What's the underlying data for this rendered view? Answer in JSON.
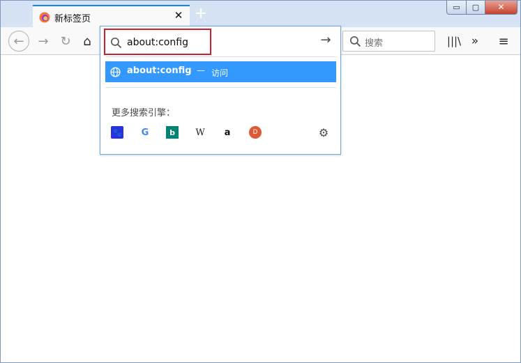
{
  "tab": {
    "title": "新标签页",
    "close_glyph": "✕"
  },
  "new_tab_glyph": "+",
  "window_controls": {
    "minimize": "▭",
    "maximize": "▢",
    "close": "✕"
  },
  "toolbar": {
    "back_icon": "←",
    "forward_icon": "→",
    "reload_icon": "↻",
    "home_icon": "⌂",
    "search_placeholder": "搜索",
    "library_icon": "|||\\",
    "overflow_icon": "»",
    "menu_icon": "≡"
  },
  "urlbar": {
    "value": "about:config",
    "go_icon": "→"
  },
  "popup": {
    "suggestion": {
      "title": "about:config",
      "dash": "—",
      "action": "访问"
    },
    "more_engines_label": "更多搜索引擎：",
    "engines": [
      {
        "name": "baidu",
        "glyph": "🐾"
      },
      {
        "name": "google",
        "glyph": "G"
      },
      {
        "name": "bing",
        "glyph": "b"
      },
      {
        "name": "wikipedia",
        "glyph": "W"
      },
      {
        "name": "amazon",
        "glyph": "a"
      },
      {
        "name": "duckduckgo",
        "glyph": "D"
      }
    ],
    "settings_glyph": "⚙"
  },
  "colors": {
    "accent": "#0a84ff",
    "highlight": "#3399ff",
    "urlbar_outline": "#c8202f",
    "update_badge": "#2ac3a2"
  }
}
